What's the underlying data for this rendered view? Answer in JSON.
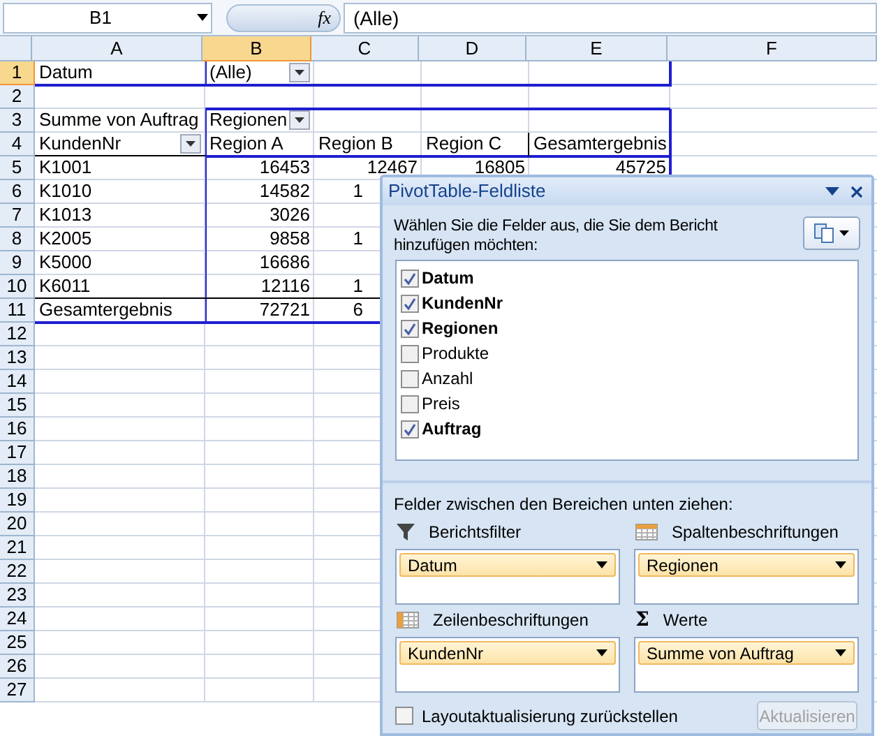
{
  "name_box": "B1",
  "formula_bar": {
    "function_label": "fx",
    "value": "(Alle)"
  },
  "columns": [
    {
      "label": "A",
      "selected": false
    },
    {
      "label": "B",
      "selected": true
    },
    {
      "label": "C",
      "selected": false
    },
    {
      "label": "D",
      "selected": false
    },
    {
      "label": "E",
      "selected": false
    },
    {
      "label": "F",
      "selected": false
    }
  ],
  "rows": [
    {
      "number": "1",
      "selected": true,
      "cells": [
        {
          "text": "Datum",
          "kind": "label"
        },
        {
          "text": "(Alle)",
          "kind": "dropdown"
        }
      ]
    },
    {
      "number": "2",
      "selected": false,
      "cells": []
    },
    {
      "number": "3",
      "selected": false,
      "cells": [
        {
          "text": "Summe von Auftrag",
          "kind": "label"
        },
        {
          "text": "Regionen",
          "kind": "dropdown"
        }
      ]
    },
    {
      "number": "4",
      "selected": false,
      "cells": [
        {
          "text": "KundenNr",
          "kind": "dropdown"
        },
        {
          "text": "Region A",
          "kind": "label"
        },
        {
          "text": "Region B",
          "kind": "label"
        },
        {
          "text": "Region C",
          "kind": "label"
        },
        {
          "text": "Gesamtergebnis",
          "kind": "label"
        }
      ]
    },
    {
      "number": "5",
      "selected": false,
      "cells": [
        {
          "text": "K1001",
          "kind": "label"
        },
        {
          "text": "16453",
          "kind": "number"
        },
        {
          "text": "12467",
          "kind": "number"
        },
        {
          "text": "16805",
          "kind": "number"
        },
        {
          "text": "45725",
          "kind": "number"
        }
      ]
    },
    {
      "number": "6",
      "selected": false,
      "cells": [
        {
          "text": "K1010",
          "kind": "label"
        },
        {
          "text": "14582",
          "kind": "number"
        },
        {
          "text": "1",
          "kind": "cut"
        }
      ]
    },
    {
      "number": "7",
      "selected": false,
      "cells": [
        {
          "text": "K1013",
          "kind": "label"
        },
        {
          "text": "3026",
          "kind": "number"
        }
      ]
    },
    {
      "number": "8",
      "selected": false,
      "cells": [
        {
          "text": "K2005",
          "kind": "label"
        },
        {
          "text": "9858",
          "kind": "number"
        },
        {
          "text": "1",
          "kind": "cut"
        }
      ]
    },
    {
      "number": "9",
      "selected": false,
      "cells": [
        {
          "text": "K5000",
          "kind": "label"
        },
        {
          "text": "16686",
          "kind": "number"
        }
      ]
    },
    {
      "number": "10",
      "selected": false,
      "cells": [
        {
          "text": "K6011",
          "kind": "label"
        },
        {
          "text": "12116",
          "kind": "number"
        },
        {
          "text": "1",
          "kind": "cut"
        }
      ]
    },
    {
      "number": "11",
      "selected": false,
      "cells": [
        {
          "text": "Gesamtergebnis",
          "kind": "label"
        },
        {
          "text": "72721",
          "kind": "number"
        },
        {
          "text": "6",
          "kind": "cut"
        }
      ]
    },
    {
      "number": "12",
      "selected": false,
      "cells": []
    },
    {
      "number": "13",
      "selected": false,
      "cells": []
    },
    {
      "number": "14",
      "selected": false,
      "cells": []
    },
    {
      "number": "15",
      "selected": false,
      "cells": []
    },
    {
      "number": "16",
      "selected": false,
      "cells": []
    },
    {
      "number": "17",
      "selected": false,
      "cells": []
    },
    {
      "number": "18",
      "selected": false,
      "cells": []
    },
    {
      "number": "19",
      "selected": false,
      "cells": []
    },
    {
      "number": "20",
      "selected": false,
      "cells": []
    },
    {
      "number": "21",
      "selected": false,
      "cells": []
    },
    {
      "number": "22",
      "selected": false,
      "cells": []
    },
    {
      "number": "23",
      "selected": false,
      "cells": []
    },
    {
      "number": "24",
      "selected": false,
      "cells": []
    },
    {
      "number": "25",
      "selected": false,
      "cells": []
    },
    {
      "number": "26",
      "selected": false,
      "cells": []
    },
    {
      "number": "27",
      "selected": false,
      "cells": []
    }
  ],
  "field_list": {
    "title": "PivotTable-Feldliste",
    "instruction": "Wählen Sie die Felder aus, die Sie dem Bericht hinzufügen möchten:",
    "fields": [
      {
        "label": "Datum",
        "checked": true
      },
      {
        "label": "KundenNr",
        "checked": true
      },
      {
        "label": "Regionen",
        "checked": true
      },
      {
        "label": "Produkte",
        "checked": false
      },
      {
        "label": "Anzahl",
        "checked": false
      },
      {
        "label": "Preis",
        "checked": false
      },
      {
        "label": "Auftrag",
        "checked": true
      }
    ],
    "drag_label": "Felder zwischen den Bereichen unten ziehen:",
    "areas": [
      {
        "title": "Berichtsfilter",
        "kind": "filter",
        "fields": [
          "Datum"
        ]
      },
      {
        "title": "Spaltenbeschriftungen",
        "kind": "columns",
        "fields": [
          "Regionen"
        ]
      },
      {
        "title": "Zeilenbeschriftungen",
        "kind": "rows",
        "fields": [
          "KundenNr"
        ]
      },
      {
        "title": "Werte",
        "kind": "values",
        "icon": "Σ",
        "fields": [
          "Summe von Auftrag"
        ]
      }
    ],
    "defer": {
      "label": "Layoutaktualisierung zurückstellen",
      "checked": false
    },
    "update_button": {
      "label": "Aktualisieren",
      "disabled": true
    }
  }
}
